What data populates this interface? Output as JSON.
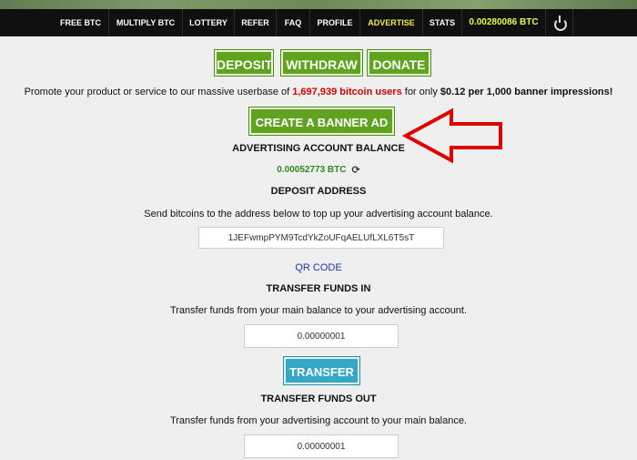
{
  "nav": {
    "items": [
      {
        "label": "FREE BTC"
      },
      {
        "label": "MULTIPLY BTC"
      },
      {
        "label": "LOTTERY"
      },
      {
        "label": "REFER"
      },
      {
        "label": "FAQ"
      },
      {
        "label": "PROFILE"
      },
      {
        "label": "ADVERTISE"
      },
      {
        "label": "STATS"
      }
    ],
    "active": "ADVERTISE",
    "balance": "0.00280086 BTC",
    "logout_icon": "power-icon"
  },
  "actions": {
    "deposit": "DEPOSIT",
    "withdraw": "WITHDRAW",
    "donate": "DONATE"
  },
  "promo": {
    "prefix": "Promote your product or service to our massive userbase of ",
    "users": "1,697,939 bitcoin users",
    "middle": " for only ",
    "price": "$0.12 per 1,000 banner impressions!"
  },
  "create_ad": "CREATE A BANNER AD",
  "ad_balance": {
    "title": "ADVERTISING ACCOUNT BALANCE",
    "value": "0.00052773 BTC",
    "refresh_icon": "refresh-icon"
  },
  "deposit_address": {
    "title": "DEPOSIT ADDRESS",
    "instructions": "Send bitcoins to the address below to top up your advertising account balance.",
    "address": "1JEFwmpPYM9TcdYkZoUFqAELUfLXL6T5sT",
    "qr_link": "QR CODE"
  },
  "transfer_in": {
    "title": "TRANSFER FUNDS IN",
    "instructions": "Transfer funds from your main balance to your advertising account.",
    "amount": "0.00000001",
    "button": "TRANSFER"
  },
  "transfer_out": {
    "title": "TRANSFER FUNDS OUT",
    "instructions": "Transfer funds from your advertising account to your main balance.",
    "amount": "0.00000001"
  },
  "colors": {
    "green_button": "#5fa31f",
    "blue_button": "#36a8c7",
    "highlight_red": "#d60000",
    "balance_green": "#2f8a1a",
    "annotation_arrow": "#e00000"
  }
}
